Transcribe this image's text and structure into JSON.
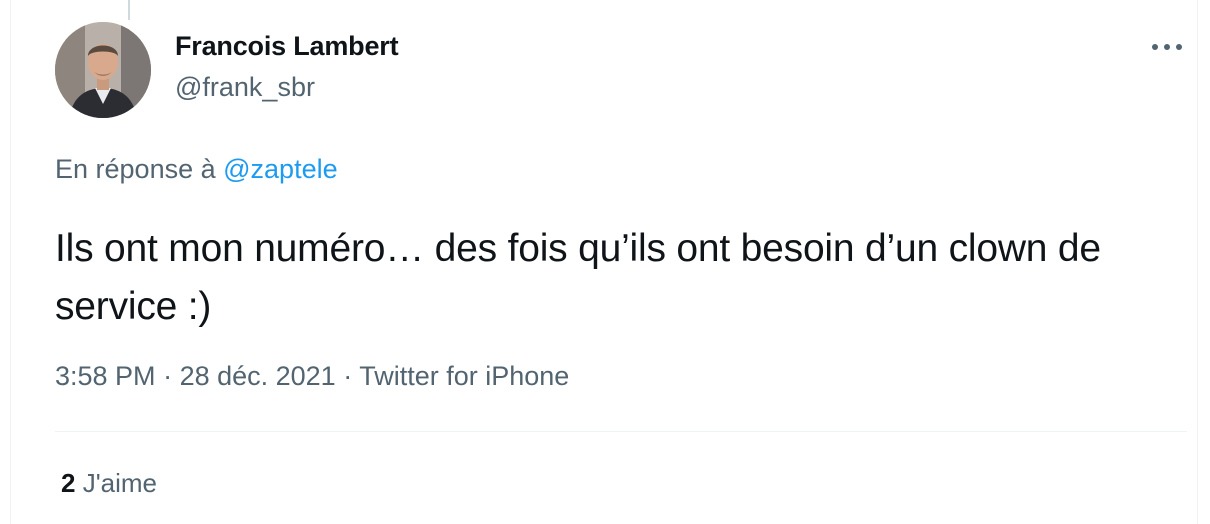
{
  "author": {
    "name": "Francois Lambert",
    "handle": "@frank_sbr",
    "avatar_icon": "profile-photo"
  },
  "reply": {
    "prefix": "En réponse à ",
    "to_handle": "@zaptele"
  },
  "tweet": {
    "text": "Ils ont mon numéro… des fois qu’ils ont besoin d’un clown de service :)"
  },
  "meta": {
    "time": "3:58 PM",
    "separator1": " · ",
    "date": "28 déc. 2021",
    "separator2": " · ",
    "source": "Twitter for iPhone"
  },
  "stats": {
    "likes_count": "2",
    "likes_label": "J'aime"
  },
  "colors": {
    "text": "#0f1419",
    "secondary": "#536471",
    "link": "#1d9bf0",
    "border": "#eff3f4"
  },
  "icons": {
    "more": "more-horizontal-icon"
  }
}
